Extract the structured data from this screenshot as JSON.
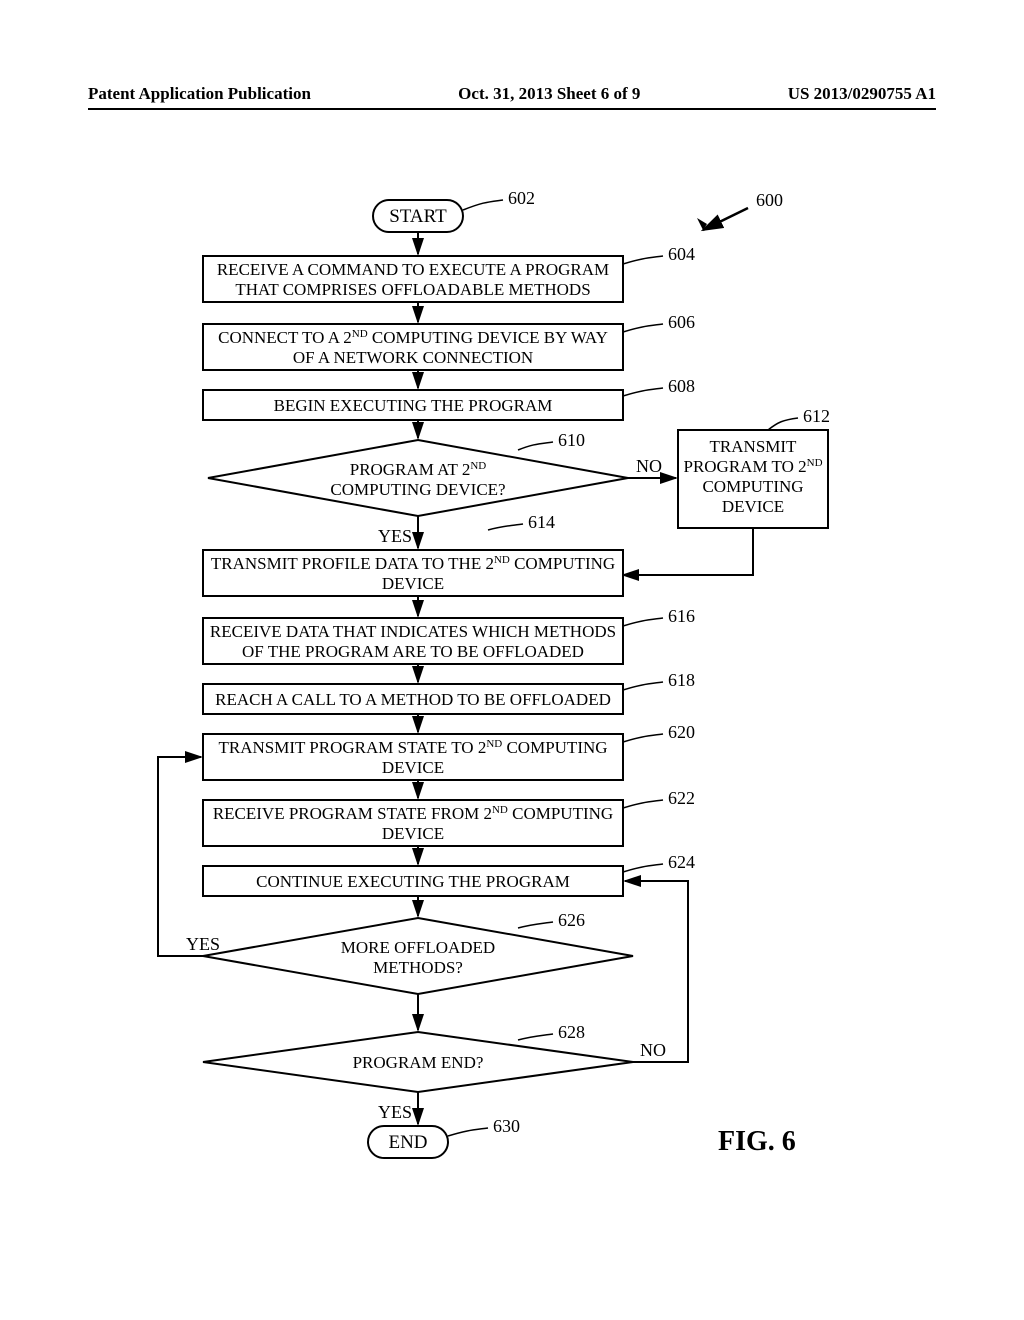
{
  "header": {
    "left": "Patent Application Publication",
    "mid": "Oct. 31, 2013  Sheet 6 of 9",
    "right": "US 2013/0290755 A1"
  },
  "refs": {
    "r600": "600",
    "r602": "602",
    "r604": "604",
    "r606": "606",
    "r608": "608",
    "r610": "610",
    "r612": "612",
    "r614": "614",
    "r616": "616",
    "r618": "618",
    "r620": "620",
    "r622": "622",
    "r624": "624",
    "r626": "626",
    "r628": "628",
    "r630": "630"
  },
  "labels": {
    "yes": "YES",
    "no": "NO"
  },
  "nodes": {
    "start": "START",
    "end": "END",
    "n604a": "RECEIVE A COMMAND TO EXECUTE A PROGRAM",
    "n604b": "THAT COMPRISES OFFLOADABLE METHODS",
    "n606a": "CONNECT TO A 2",
    "n606sup": "ND",
    "n606b": " COMPUTING DEVICE BY WAY",
    "n606c": "OF A NETWORK CONNECTION",
    "n608": "BEGIN EXECUTING THE PROGRAM",
    "n610a": "PROGRAM AT 2",
    "n610sup": "ND",
    "n610b": "COMPUTING DEVICE?",
    "n612a": "TRANSMIT",
    "n612b": "PROGRAM TO 2",
    "n612sup": "ND",
    "n612c": "COMPUTING",
    "n612d": "DEVICE",
    "n614a": "TRANSMIT PROFILE DATA TO THE 2",
    "n614sup": "ND",
    "n614b": " COMPUTING",
    "n614c": "DEVICE",
    "n616a": "RECEIVE DATA THAT INDICATES WHICH METHODS",
    "n616b": "OF THE PROGRAM ARE TO BE OFFLOADED",
    "n618": "REACH A CALL TO A METHOD TO BE OFFLOADED",
    "n620a": "TRANSMIT PROGRAM STATE TO 2",
    "n620sup": "ND",
    "n620b": " COMPUTING",
    "n620c": "DEVICE",
    "n622a": "RECEIVE PROGRAM STATE FROM 2",
    "n622sup": "ND",
    "n622b": " COMPUTING",
    "n622c": "DEVICE",
    "n624": "CONTINUE EXECUTING THE PROGRAM",
    "n626a": "MORE OFFLOADED",
    "n626b": "METHODS?",
    "n628": "PROGRAM END?"
  },
  "figure": "FIG. 6"
}
